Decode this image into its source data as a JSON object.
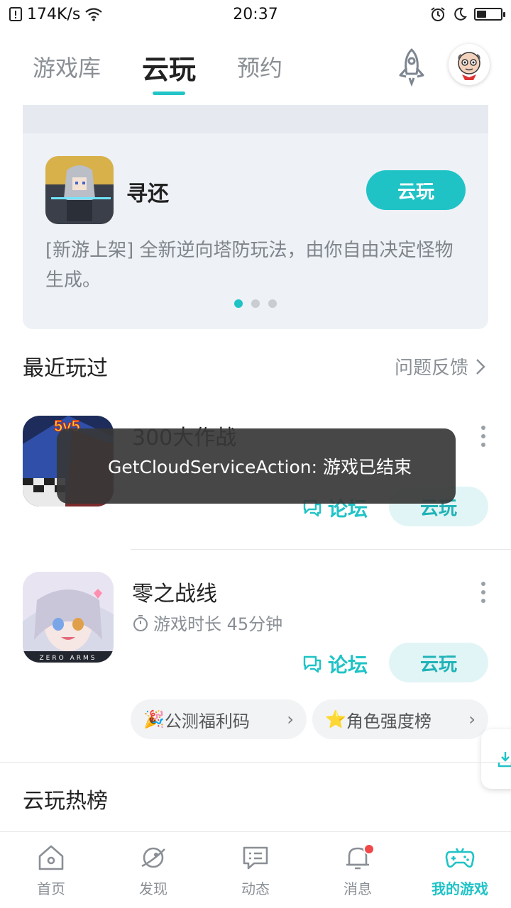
{
  "status_bar": {
    "speed": "174K/s",
    "time": "20:37",
    "battery_level": 0.4
  },
  "top_tabs": [
    {
      "label": "游戏库",
      "active": false
    },
    {
      "label": "云玩",
      "active": true
    },
    {
      "label": "预约",
      "active": false
    }
  ],
  "banner": {
    "game_title": "寻还",
    "button_label": "云玩",
    "description": "[新游上架] 全新逆向塔防玩法，由你自由决定怪物生成。",
    "dots_count": 3,
    "active_dot": 0
  },
  "recent": {
    "title": "最近玩过",
    "feedback_label": "问题反馈",
    "games": [
      {
        "name": "300大作战",
        "playtime": "",
        "forum_label": "论坛",
        "cloud_label": "云玩",
        "icon_text": "5v5"
      },
      {
        "name": "零之战线",
        "playtime": "游戏时长 45分钟",
        "forum_label": "论坛",
        "cloud_label": "云玩",
        "icon_text": "ZERO ARMS"
      }
    ],
    "chips": [
      {
        "label": "公测福利码",
        "emoji": "🎉"
      },
      {
        "label": "角色强度榜",
        "emoji": "⭐"
      }
    ]
  },
  "hot": {
    "title": "云玩热榜"
  },
  "toast": {
    "message": "GetCloudServiceAction: 游戏已结束"
  },
  "bottom_nav": [
    {
      "label": "首页",
      "icon": "home-icon",
      "active": false
    },
    {
      "label": "发现",
      "icon": "planet-icon",
      "active": false
    },
    {
      "label": "动态",
      "icon": "chat-icon",
      "active": false
    },
    {
      "label": "消息",
      "icon": "bell-icon",
      "active": false,
      "badge": true
    },
    {
      "label": "我的游戏",
      "icon": "gamepad-icon",
      "active": true
    }
  ],
  "colors": {
    "accent": "#1fc3c6",
    "muted": "#8a8f95"
  }
}
